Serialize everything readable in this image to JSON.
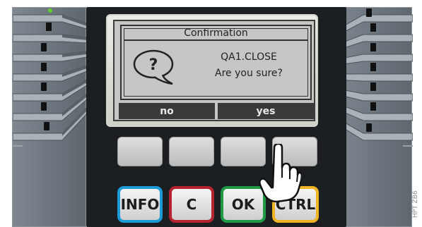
{
  "dialog": {
    "title": "Confirmation",
    "line1": "QA1.CLOSE",
    "line2": "Are you sure?",
    "icon": "question-bubble-icon",
    "icon_glyph": "?"
  },
  "softkeys": {
    "left": "no",
    "right": "yes"
  },
  "function_keys": [
    {
      "label": "INFO",
      "color": "#1b9ad6"
    },
    {
      "label": "C",
      "color": "#b5232e"
    },
    {
      "label": "OK",
      "color": "#1e9a45"
    },
    {
      "label": "CTRL",
      "color": "#f0b323"
    }
  ],
  "hand_icon": "pointing-hand-icon",
  "figure_code": "HPT ZB6"
}
